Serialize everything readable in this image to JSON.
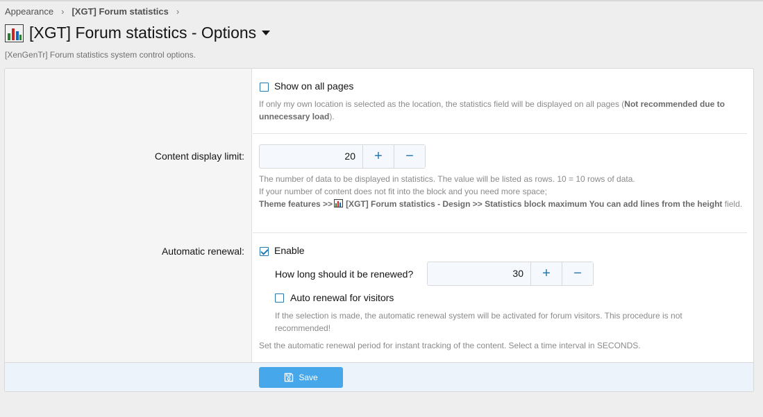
{
  "breadcrumb": {
    "items": [
      "Appearance",
      "[XGT] Forum statistics"
    ],
    "separator": "›"
  },
  "page": {
    "title": "[XGT] Forum statistics - Options",
    "title_icon": "bar-chart-icon",
    "description": "[XenGenTr] Forum statistics system control options."
  },
  "options": {
    "show_all_pages": {
      "label": "Show on all pages",
      "checked": false,
      "hint_text": "If only my own location is selected as the location, the statistics field will be displayed on all pages (",
      "hint_bold": "Not recommended due to unnecessary load",
      "hint_end": ")."
    },
    "content_limit": {
      "label": "Content display limit:",
      "value": "20",
      "increment": "+",
      "decrement": "−",
      "hint_line1": "The number of data to be displayed in statistics. The value will be listed as rows. 10 = 10 rows of data.",
      "hint_line2": "If your number of content does not fit into the block and you need more space;",
      "hint_bold1": "Theme features >>",
      "hint_bold2": "[XGT] Forum statistics - Design >> Statistics block maximum You can add lines from the height",
      "hint_end": " field."
    },
    "auto_renewal": {
      "label": "Automatic renewal:",
      "enable_label": "Enable",
      "enabled": true,
      "renew_question": "How long should it be renewed?",
      "renew_value": "30",
      "increment": "+",
      "decrement": "−",
      "visitors_label": "Auto renewal for visitors",
      "visitors_checked": false,
      "visitors_hint": "If the selection is made, the automatic renewal system will be activated for forum visitors. This procedure is not recommended!",
      "hint": "Set the automatic renewal period for instant tracking of the content. Select a time interval in SECONDS."
    }
  },
  "footer": {
    "save_label": "Save",
    "save_icon": "floppy-disk-icon"
  },
  "colors": {
    "accent": "#2577b1",
    "save_button": "#47a7eb",
    "footer_bg": "#edf3fb"
  }
}
